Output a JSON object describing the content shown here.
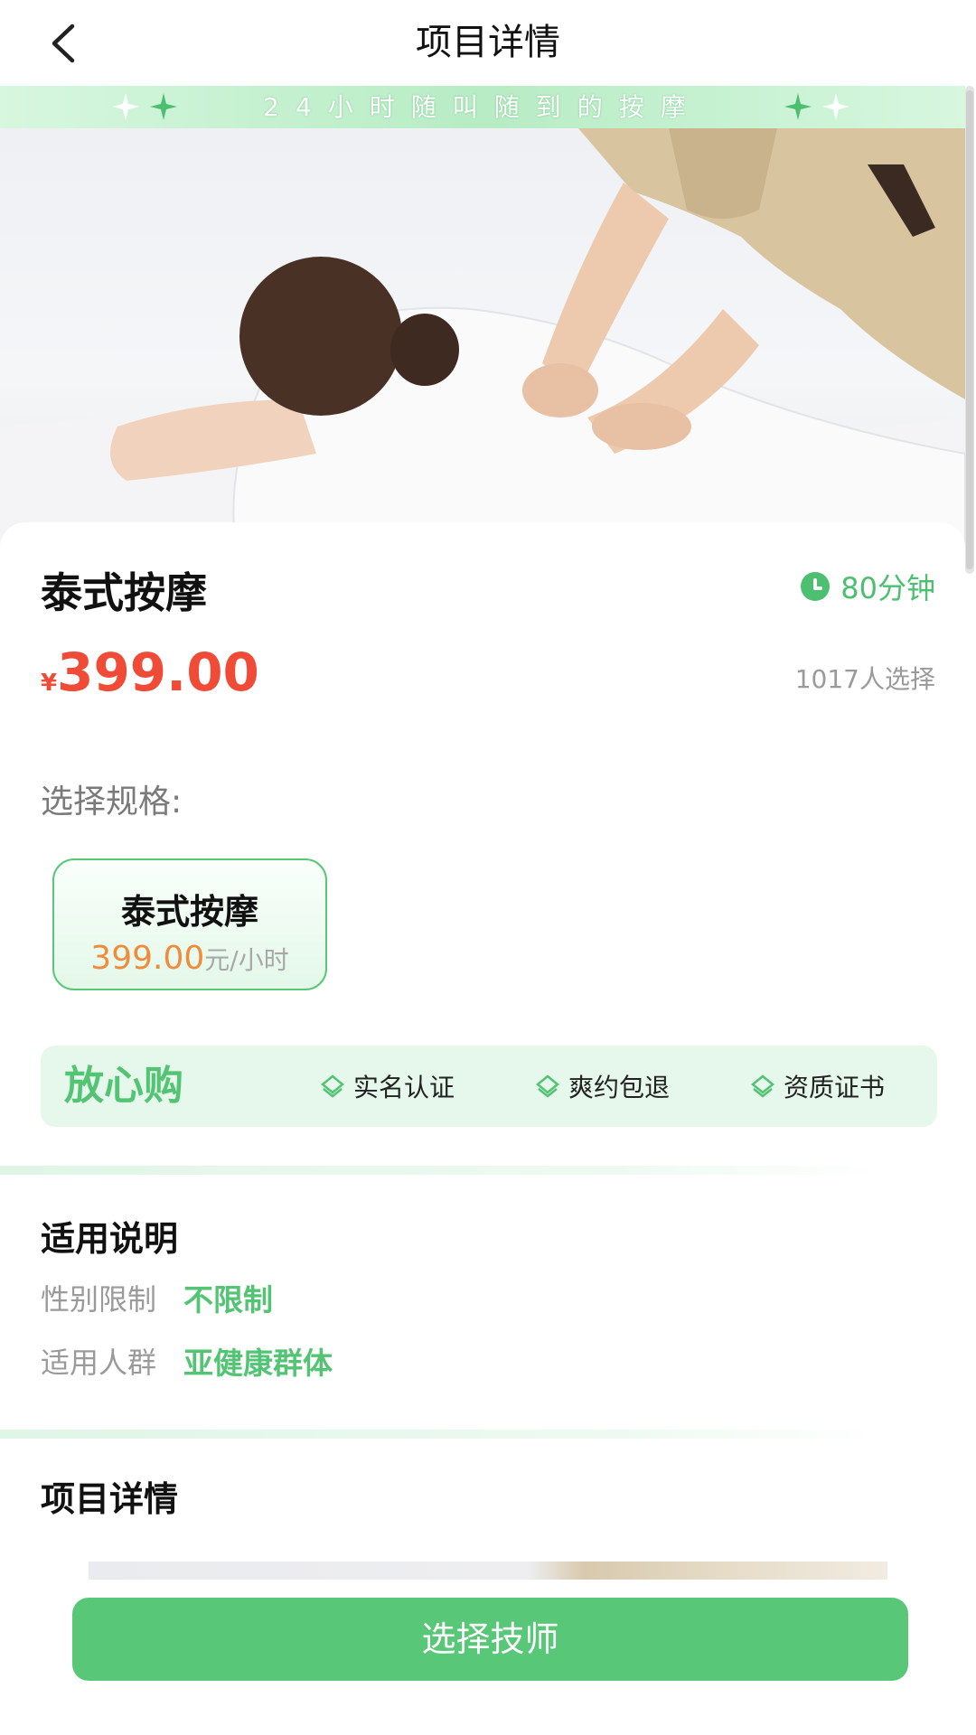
{
  "header": {
    "title": "项目详情"
  },
  "banner": {
    "text": "24小时随叫随到的按摩"
  },
  "product": {
    "name": "泰式按摩",
    "duration": "80分钟",
    "currency": "¥",
    "price": "399.00",
    "selected_count": "1017人选择"
  },
  "spec": {
    "label": "选择规格:",
    "options": [
      {
        "name": "泰式按摩",
        "price": "399.00",
        "unit": "元/小时"
      }
    ]
  },
  "assurance": {
    "title": "放心购",
    "items": [
      "实名认证",
      "爽约包退",
      "资质证书"
    ]
  },
  "applicability": {
    "title": "适用说明",
    "rows": [
      {
        "key": "性别限制",
        "value": "不限制"
      },
      {
        "key": "适用人群",
        "value": "亚健康群体"
      }
    ]
  },
  "details": {
    "title": "项目详情"
  },
  "action": {
    "button": "选择技师"
  },
  "colors": {
    "accent": "#58c777",
    "price": "#ef4b36",
    "spec_price": "#f08b3a"
  },
  "icons": [
    "back-arrow-icon",
    "sparkle-icon",
    "clock-icon",
    "diamond-check-icon"
  ]
}
